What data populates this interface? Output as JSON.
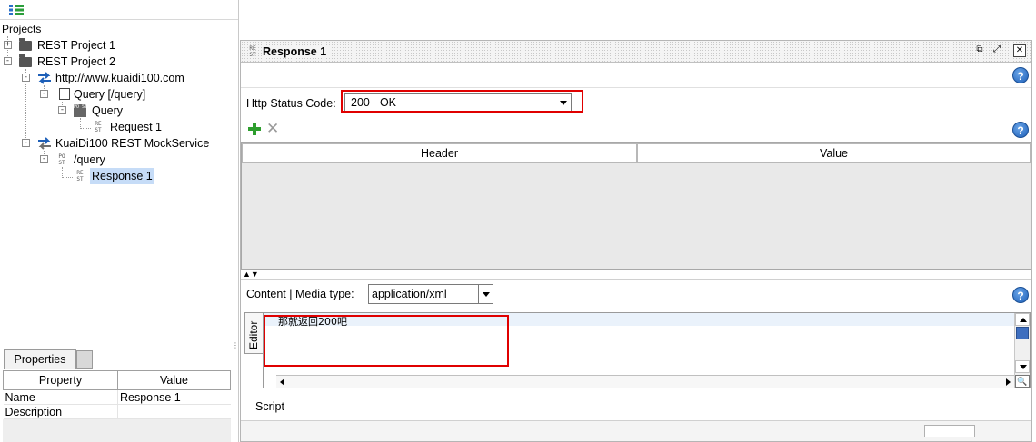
{
  "navigator": {
    "projects_label": "Projects",
    "tree": [
      {
        "label": "REST Project 1",
        "expander": "+"
      },
      {
        "label": "REST Project 2",
        "expander": "-"
      },
      {
        "label": "http://www.kuaidi100.com",
        "expander": "-"
      },
      {
        "label": "Query [/query]",
        "expander": "-"
      },
      {
        "label": "Query",
        "expander": "-"
      },
      {
        "label": "Request 1"
      },
      {
        "label": "KuaiDi100 REST MockService",
        "expander": "-"
      },
      {
        "label": "/query",
        "expander": "-"
      },
      {
        "label": "Response 1"
      }
    ],
    "rest_badge": "RE\nST",
    "post_badge": "PO\nST"
  },
  "properties": {
    "tab_label": "Properties",
    "columns": [
      "Property",
      "Value"
    ],
    "rows": [
      {
        "property": "Name",
        "value": "Response 1"
      },
      {
        "property": "Description",
        "value": ""
      }
    ]
  },
  "response_panel": {
    "title": "Response 1",
    "status_code_label": "Http Status Code:",
    "status_code_value": "200 - OK",
    "headers_columns": [
      "Header",
      "Value"
    ],
    "content_label": "Content | Media type:",
    "media_type_value": "application/xml",
    "editor_tab_label": "Editor",
    "editor_text": "那就返回200吧",
    "script_label": "Script"
  },
  "icons": {
    "help": "?",
    "add": "add-icon",
    "remove": "remove-icon",
    "splitter": "▲▼"
  },
  "colors": {
    "highlight_red": "#e00000",
    "selection_blue": "#c6dcf7",
    "add_green": "#2e9e2e"
  }
}
